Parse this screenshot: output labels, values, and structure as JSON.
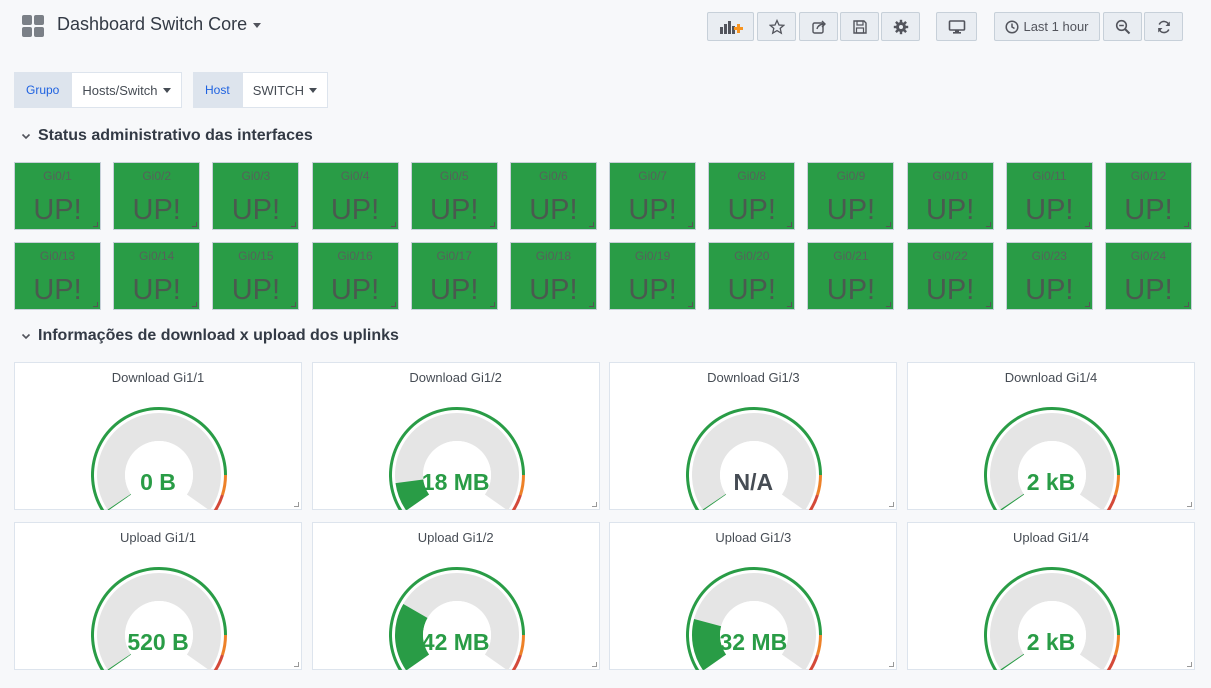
{
  "header": {
    "title": "Dashboard Switch Core",
    "time_range": "Last 1 hour"
  },
  "variables": [
    {
      "label": "Grupo",
      "value": "Hosts/Switch"
    },
    {
      "label": "Host",
      "value": "SWITCH"
    }
  ],
  "rows": [
    {
      "title": "Status administrativo das interfaces"
    },
    {
      "title": "Informações de download x upload dos uplinks"
    }
  ],
  "interfaces": [
    {
      "name": "Gi0/1",
      "status": "UP!"
    },
    {
      "name": "Gi0/2",
      "status": "UP!"
    },
    {
      "name": "Gi0/3",
      "status": "UP!"
    },
    {
      "name": "Gi0/4",
      "status": "UP!"
    },
    {
      "name": "Gi0/5",
      "status": "UP!"
    },
    {
      "name": "Gi0/6",
      "status": "UP!"
    },
    {
      "name": "Gi0/7",
      "status": "UP!"
    },
    {
      "name": "Gi0/8",
      "status": "UP!"
    },
    {
      "name": "Gi0/9",
      "status": "UP!"
    },
    {
      "name": "Gi0/10",
      "status": "UP!"
    },
    {
      "name": "Gi0/11",
      "status": "UP!"
    },
    {
      "name": "Gi0/12",
      "status": "UP!"
    },
    {
      "name": "Gi0/13",
      "status": "UP!"
    },
    {
      "name": "Gi0/14",
      "status": "UP!"
    },
    {
      "name": "Gi0/15",
      "status": "UP!"
    },
    {
      "name": "Gi0/16",
      "status": "UP!"
    },
    {
      "name": "Gi0/17",
      "status": "UP!"
    },
    {
      "name": "Gi0/18",
      "status": "UP!"
    },
    {
      "name": "Gi0/19",
      "status": "UP!"
    },
    {
      "name": "Gi0/20",
      "status": "UP!"
    },
    {
      "name": "Gi0/21",
      "status": "UP!"
    },
    {
      "name": "Gi0/22",
      "status": "UP!"
    },
    {
      "name": "Gi0/23",
      "status": "UP!"
    },
    {
      "name": "Gi0/24",
      "status": "UP!"
    }
  ],
  "gauges": [
    {
      "title": "Download Gi1/1",
      "value": "0 B",
      "fill": 0.0
    },
    {
      "title": "Download Gi1/2",
      "value": "18 MB",
      "fill": 0.11
    },
    {
      "title": "Download Gi1/3",
      "value": "N/A",
      "fill": 0.0
    },
    {
      "title": "Download Gi1/4",
      "value": "2 kB",
      "fill": 0.005
    },
    {
      "title": "Upload Gi1/1",
      "value": "520 B",
      "fill": 0.003
    },
    {
      "title": "Upload Gi1/2",
      "value": "42 MB",
      "fill": 0.26
    },
    {
      "title": "Upload Gi1/3",
      "value": "32 MB",
      "fill": 0.2
    },
    {
      "title": "Upload Gi1/4",
      "value": "2 kB",
      "fill": 0.005
    }
  ],
  "colors": {
    "status_ok": "#299c46",
    "gauge_value": "#299c46",
    "gauge_na": "#464c54",
    "threshold_warn": "#ed8128",
    "threshold_crit": "#d44a3a",
    "gauge_bg": "#e5e5e5"
  },
  "icons": {
    "dashboard": "grid-icon",
    "add_panel": "add-panel-icon",
    "star": "star-icon",
    "share": "share-icon",
    "save": "save-icon",
    "settings": "gear-icon",
    "tv_mode": "monitor-icon",
    "time": "clock-icon",
    "zoom_out": "zoom-out-icon",
    "refresh": "refresh-icon",
    "row_toggle": "chevron-down-icon"
  }
}
